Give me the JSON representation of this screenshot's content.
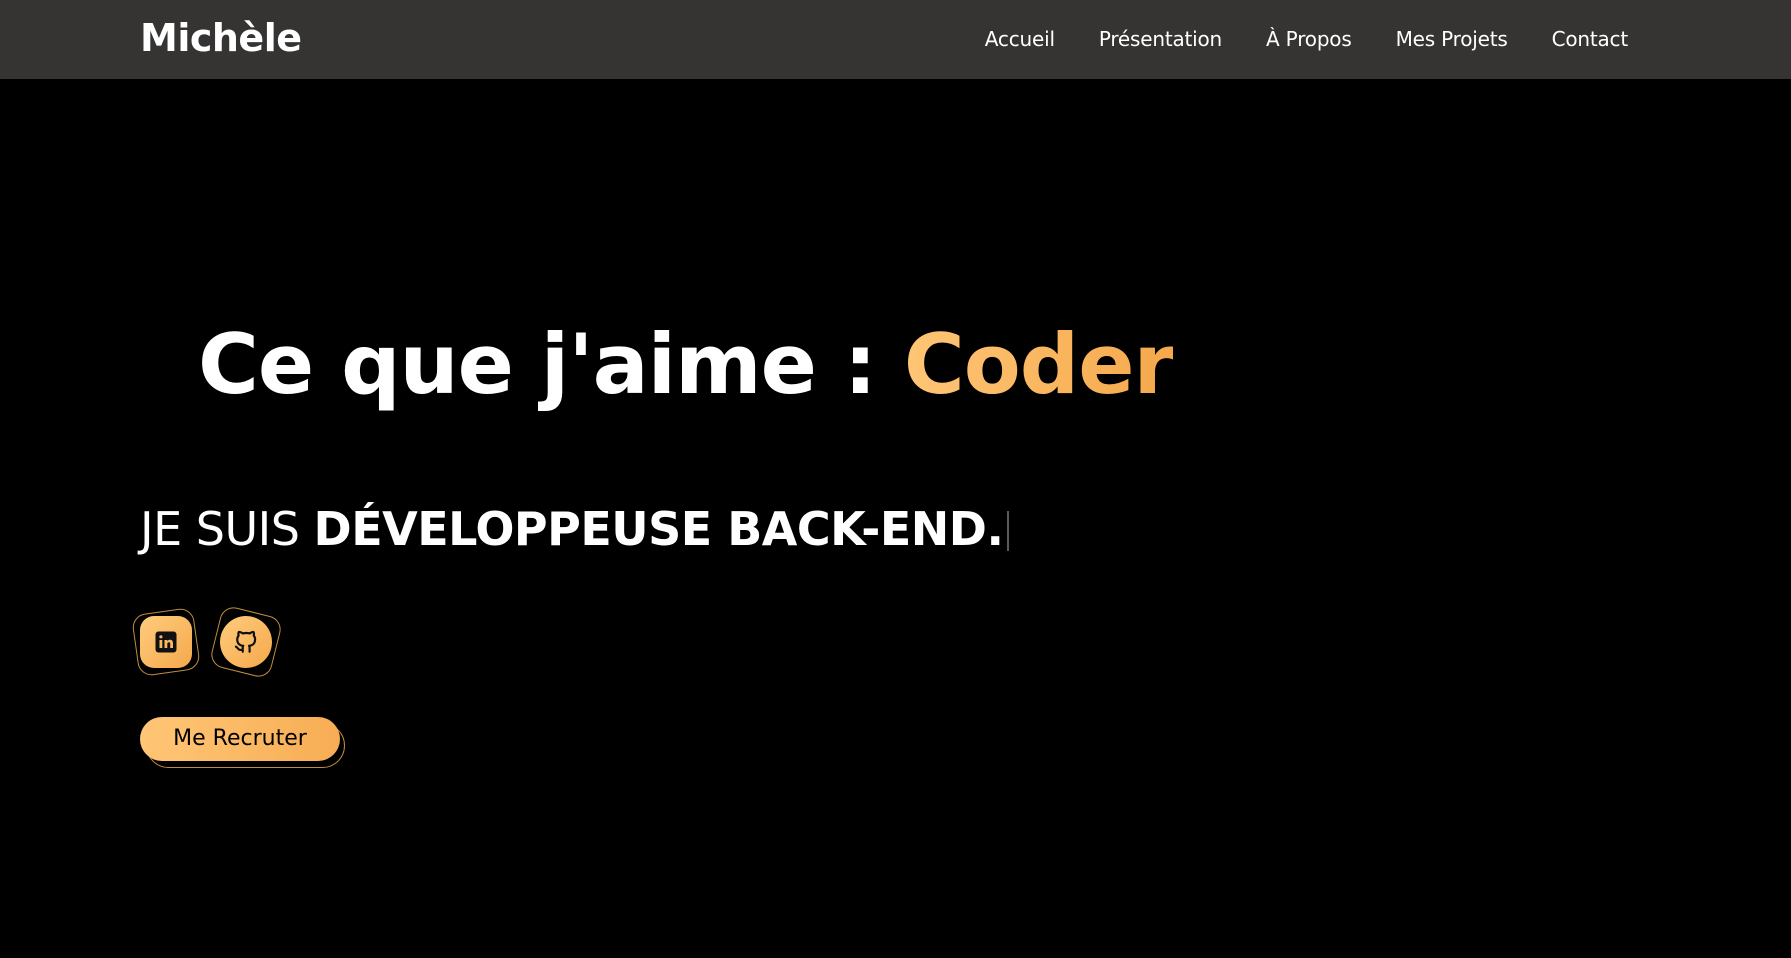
{
  "header": {
    "brand": "Michèle",
    "nav": [
      {
        "label": "Accueil"
      },
      {
        "label": "Présentation"
      },
      {
        "label": "À Propos"
      },
      {
        "label": "Mes Projets"
      },
      {
        "label": "Contact"
      }
    ]
  },
  "hero": {
    "title_prefix": "Ce que j'aime : ",
    "title_accent": "Coder",
    "subtitle_light": "JE SUIS ",
    "subtitle_strong": "DÉVELOPPEUSE BACK-END.",
    "socials": [
      {
        "icon": "linkedin-icon"
      },
      {
        "icon": "github-icon"
      }
    ],
    "cta_label": "Me Recruter"
  },
  "colors": {
    "navbar_bg": "#353433",
    "page_bg": "#000000",
    "accent_start": "#ffc676",
    "accent_end": "#f5a84c",
    "text": "#ffffff"
  }
}
